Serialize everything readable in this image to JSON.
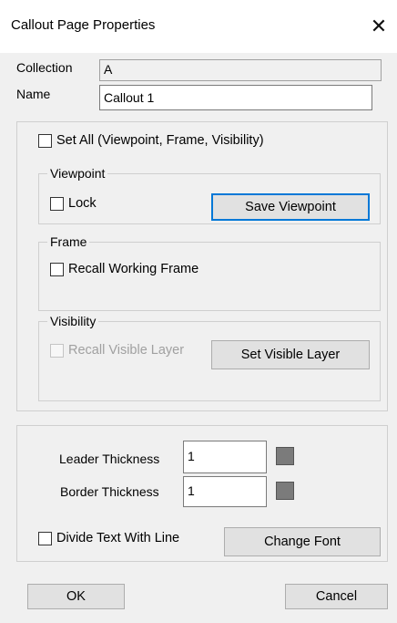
{
  "window": {
    "title": "Callout Page Properties",
    "close_icon": "close-icon"
  },
  "fields": {
    "collection_label": "Collection",
    "collection_value": "A",
    "name_label": "Name",
    "name_value": "Callout 1"
  },
  "set_all": {
    "label": "Set All (Viewpoint, Frame, Visibility)",
    "checked": false
  },
  "viewpoint": {
    "legend": "Viewpoint",
    "lock_label": "Lock",
    "lock_checked": false,
    "save_button": "Save Viewpoint"
  },
  "frame": {
    "legend": "Frame",
    "recall_label": "Recall Working Frame",
    "recall_checked": false
  },
  "visibility": {
    "legend": "Visibility",
    "recall_label": "Recall Visible Layer",
    "recall_checked": false,
    "recall_enabled": false,
    "set_button": "Set Visible Layer"
  },
  "appearance": {
    "leader_label": "Leader Thickness",
    "leader_value": "1",
    "leader_color": "#7b7b7b",
    "border_label": "Border Thickness",
    "border_value": "1",
    "border_color": "#7b7b7b",
    "divide_label": "Divide Text With Line",
    "divide_checked": false,
    "font_button": "Change Font"
  },
  "footer": {
    "ok": "OK",
    "cancel": "Cancel"
  }
}
